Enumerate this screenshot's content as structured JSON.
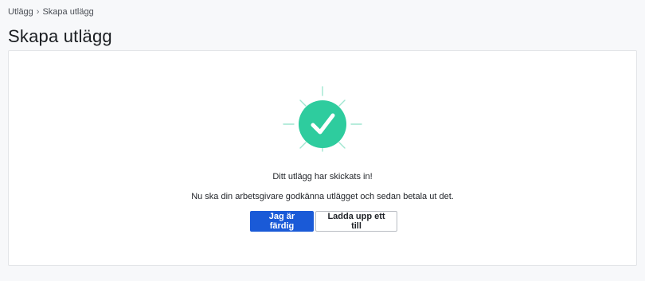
{
  "breadcrumb": {
    "items": [
      "Utlägg",
      "Skapa utlägg"
    ],
    "separator": "›"
  },
  "page": {
    "title": "Skapa utlägg"
  },
  "confirmation": {
    "icon": "checkmark-circle-icon",
    "accent_color": "#2ecc9e",
    "heading": "Ditt utlägg har skickats in!",
    "description": "Nu ska din arbetsgivare godkänna utlägget och sedan betala ut det."
  },
  "actions": {
    "done_label": "Jag är färdig",
    "upload_more_label": "Ladda upp ett till"
  }
}
